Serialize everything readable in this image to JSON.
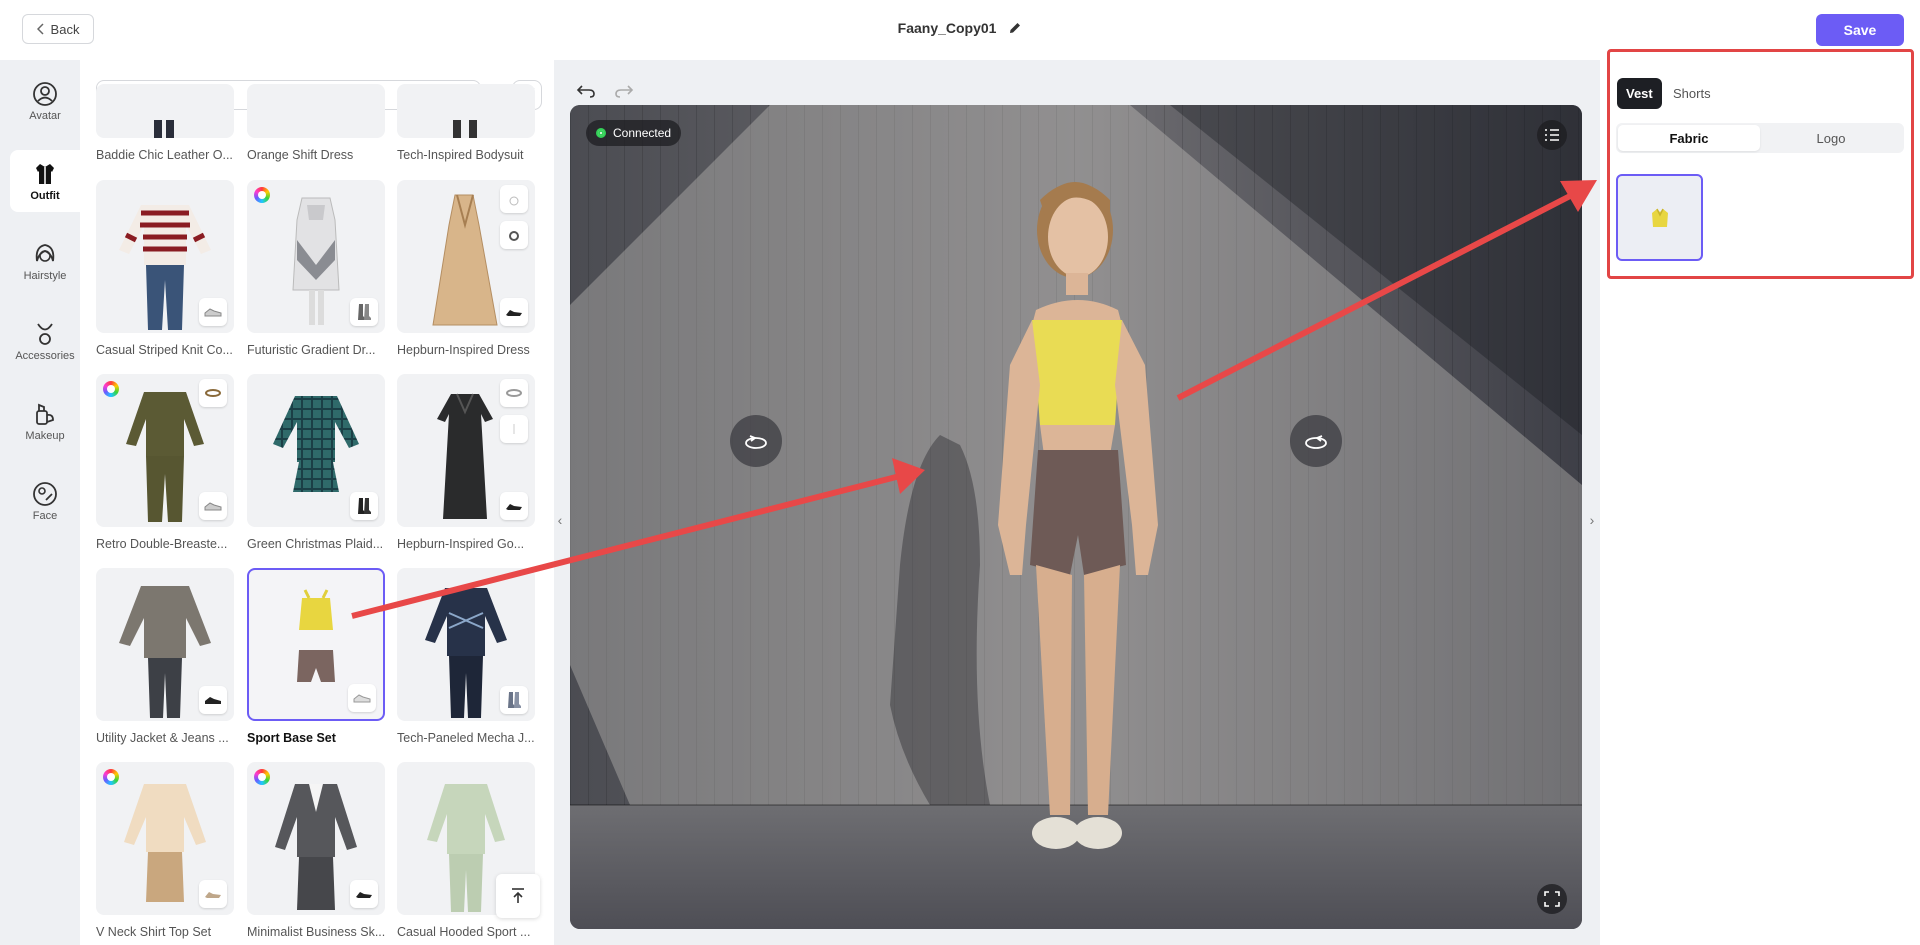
{
  "header": {
    "back_label": "Back",
    "title": "Faany_Copy01",
    "save_label": "Save"
  },
  "nav": {
    "items": [
      {
        "label": "Avatar",
        "icon": "avatar-icon"
      },
      {
        "label": "Outfit",
        "icon": "outfit-icon",
        "active": true
      },
      {
        "label": "Hairstyle",
        "icon": "hairstyle-icon"
      },
      {
        "label": "Accessories",
        "icon": "accessories-icon"
      },
      {
        "label": "Makeup",
        "icon": "makeup-icon"
      },
      {
        "label": "Face",
        "icon": "face-icon"
      }
    ]
  },
  "outfits": {
    "search_placeholder": "",
    "items": [
      {
        "name": "Baddie Chic Leather O..."
      },
      {
        "name": "Orange Shift Dress"
      },
      {
        "name": "Tech-Inspired Bodysuit"
      },
      {
        "name": "Casual Striped Knit Co..."
      },
      {
        "name": "Futuristic Gradient Dr..."
      },
      {
        "name": "Hepburn-Inspired Dress"
      },
      {
        "name": "Retro Double-Breaste..."
      },
      {
        "name": "Green Christmas Plaid..."
      },
      {
        "name": "Hepburn-Inspired Go..."
      },
      {
        "name": "Utility Jacket & Jeans ..."
      },
      {
        "name": "Sport Base Set",
        "selected": true
      },
      {
        "name": "Tech-Paneled Mecha J..."
      },
      {
        "name": "V Neck Shirt Top Set"
      },
      {
        "name": "Minimalist Business Sk..."
      },
      {
        "name": "Casual Hooded Sport ..."
      }
    ]
  },
  "viewport": {
    "status": "Connected"
  },
  "right_panel": {
    "part_tabs": [
      "Vest",
      "Shorts"
    ],
    "active_part": "Vest",
    "sub_tabs": [
      "Fabric",
      "Logo"
    ],
    "active_sub": "Fabric"
  },
  "colors": {
    "accent": "#6c5cf5",
    "annotation": "#e24545",
    "connected": "#34d058"
  }
}
